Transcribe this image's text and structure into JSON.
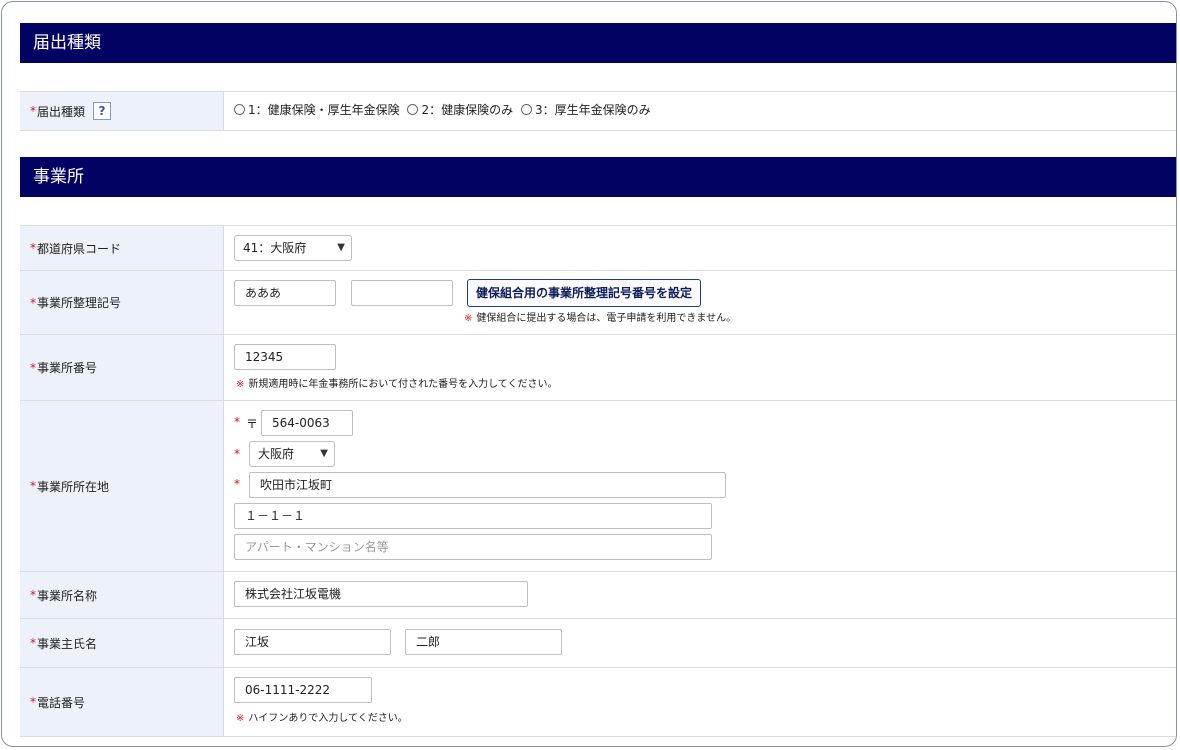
{
  "sections": {
    "notification_type": {
      "title": "届出種類"
    },
    "office": {
      "title": "事業所"
    }
  },
  "fields": {
    "notification_type": {
      "required_mark": "*",
      "label": "届出種類",
      "help": "?",
      "options": [
        "1：健康保険・厚生年金保険",
        "2：健康保険のみ",
        "3：厚生年金保険のみ"
      ]
    },
    "prefecture_code": {
      "required_mark": "*",
      "label": "都道府県コード",
      "value": "41：大阪府"
    },
    "office_reg_symbol": {
      "required_mark": "*",
      "label": "事業所整理記号",
      "value1": "あああ",
      "value2": "",
      "button": "健保組合用の事業所整理記号番号を設定",
      "note_mark": "※",
      "note": "健保組合に提出する場合は、電子申請を利用できません。"
    },
    "office_number": {
      "required_mark": "*",
      "label": "事業所番号",
      "value": "12345",
      "note_mark": "※",
      "note": "新規適用時に年金事務所において付された番号を入力してください。"
    },
    "office_address": {
      "required_mark": "*",
      "label": "事業所所在地",
      "postal_mark": "〒",
      "postal": "564-0063",
      "prefecture": "大阪府",
      "city": "吹田市江坂町",
      "street": "１－１－１",
      "building_placeholder": "アパート・マンション名等"
    },
    "office_name": {
      "required_mark": "*",
      "label": "事業所名称",
      "value": "株式会社江坂電機"
    },
    "owner_name": {
      "required_mark": "*",
      "label": "事業主氏名",
      "last": "江坂",
      "first": "二郎"
    },
    "phone": {
      "required_mark": "*",
      "label": "電話番号",
      "value": "06-1111-2222",
      "note_mark": "※",
      "note": "ハイフンありで入力してください。"
    }
  },
  "colors": {
    "header_bg": "#020262",
    "label_bg": "#edf2fa",
    "required": "#dd1111"
  },
  "icons": {
    "select_chevron": "chevron-down-icon",
    "radio": "radio-button-icon"
  }
}
